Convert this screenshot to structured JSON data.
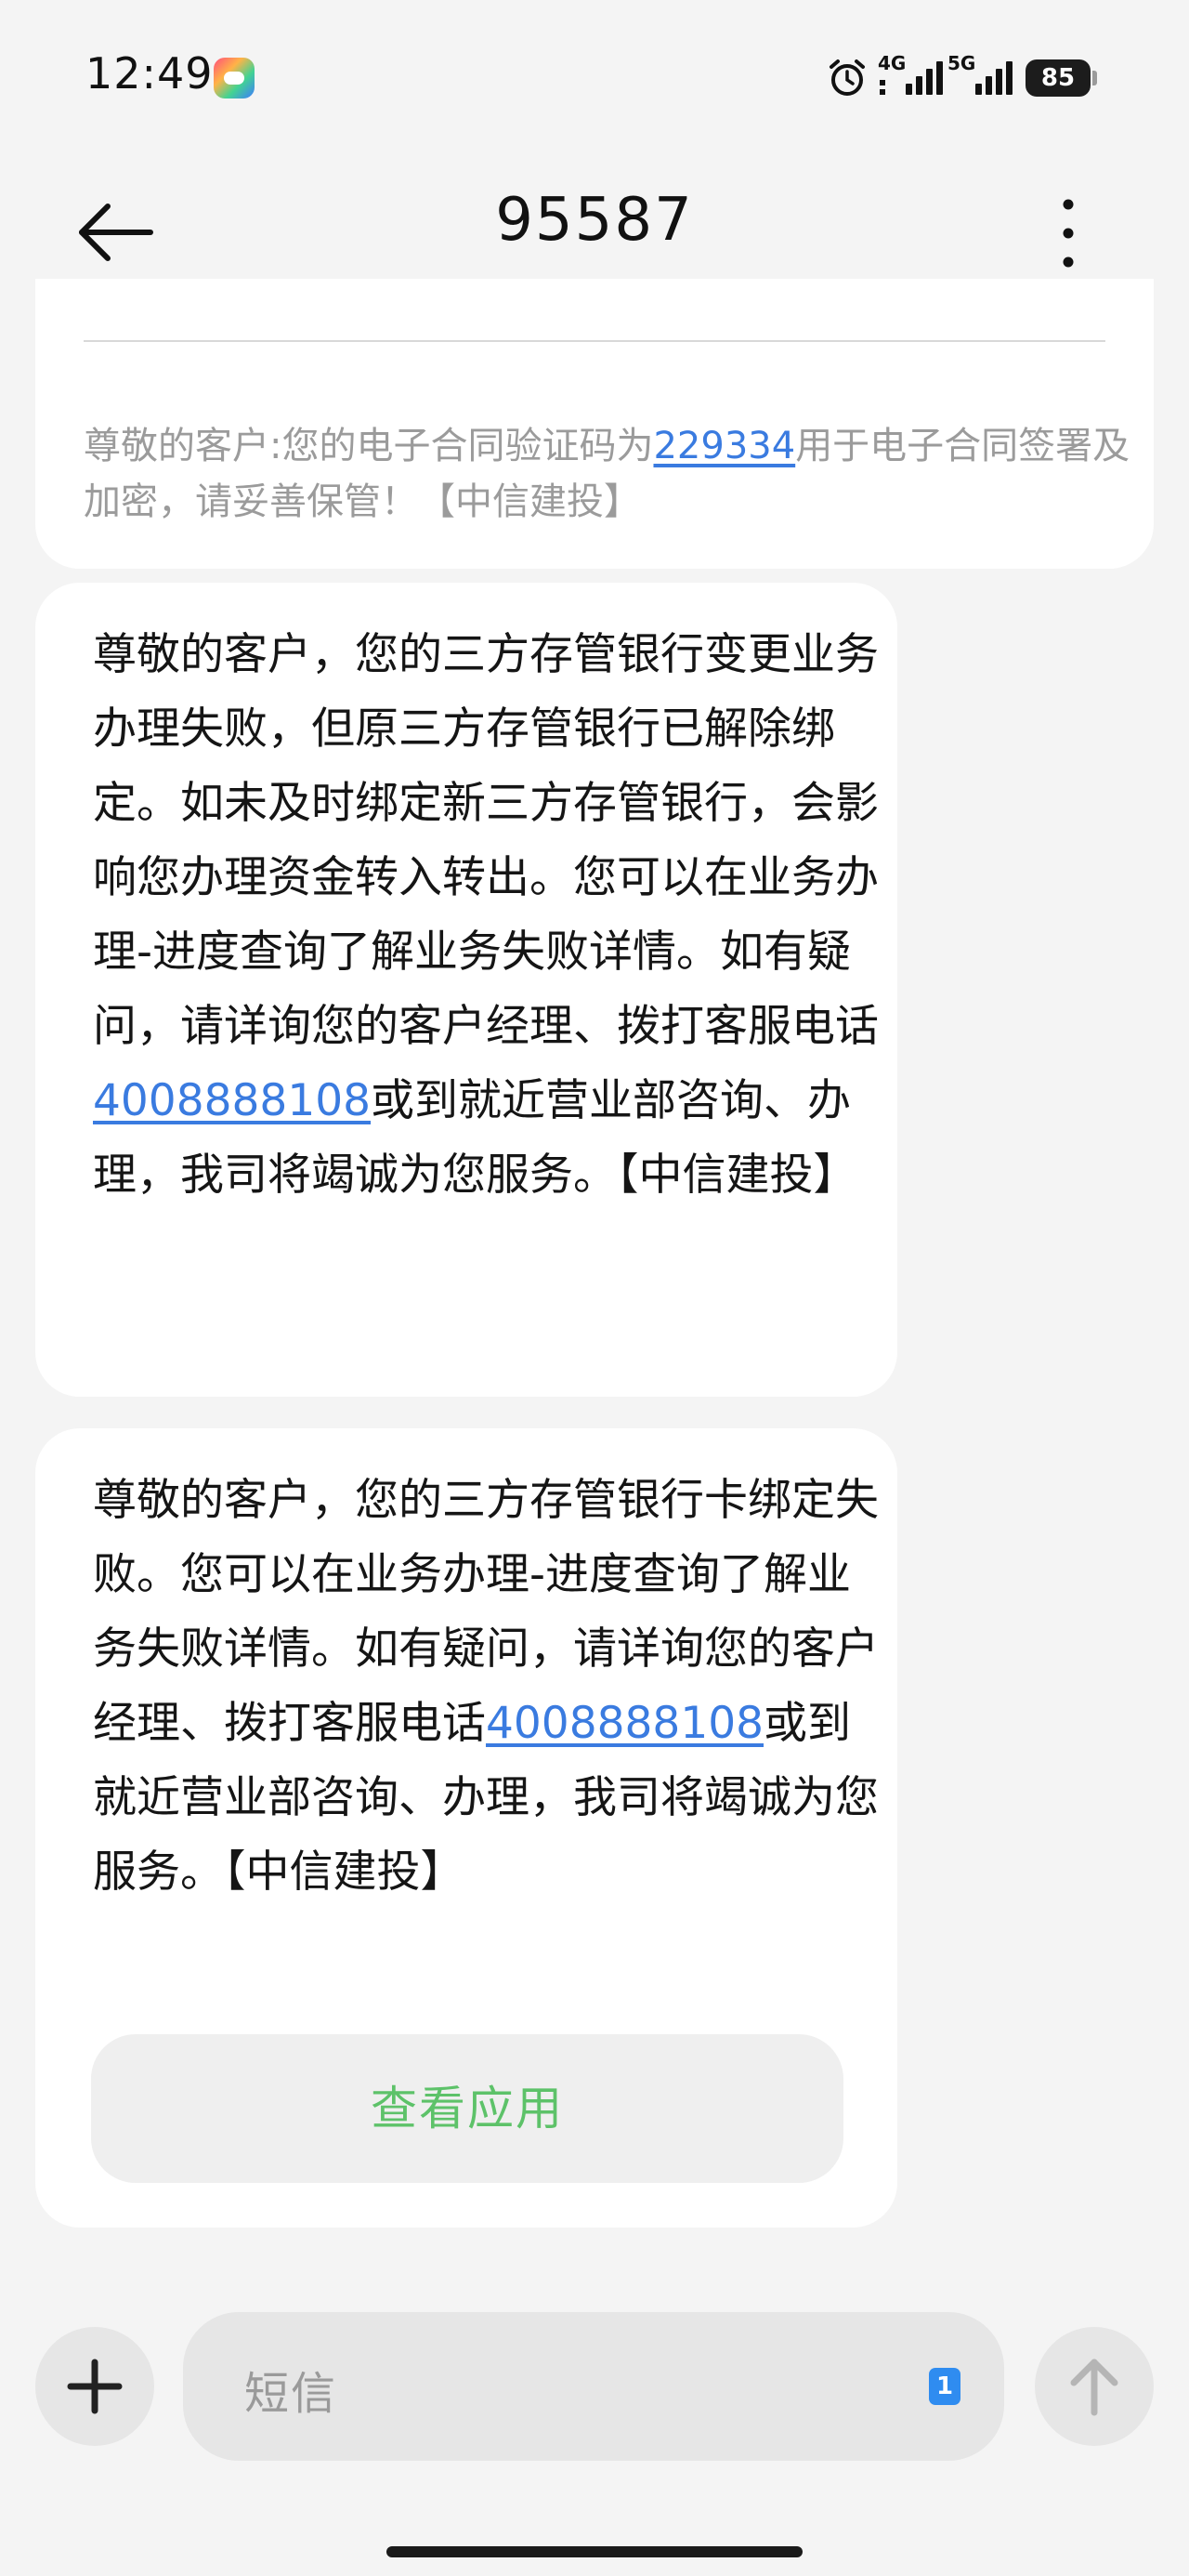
{
  "status_bar": {
    "time": "12:49",
    "network_1": "4G",
    "network_2": "5G",
    "battery": "85"
  },
  "header": {
    "title": "95587"
  },
  "messages": [
    {
      "pre": "尊敬的客户:您的电子合同验证码为",
      "link": "229334",
      "post": "用于电子合同签署及加密，请妥善保管！【中信建投】"
    },
    {
      "pre": "尊敬的客户，您的三方存管银行变更业务办理失败，但原三方存管银行已解除绑定。如未及时绑定新三方存管银行，会影响您办理资金转入转出。您可以在业务办理-进度查询了解业务失败详情。如有疑问，请详询您的客户经理、拨打客服电话",
      "link": "4008888108",
      "post": "或到就近营业部咨询、办理，我司将竭诚为您服务。【中信建投】"
    },
    {
      "pre": "尊敬的客户，您的三方存管银行卡绑定失败。您可以在业务办理-进度查询了解业务失败详情。如有疑问，请详询您的客户经理、拨打客服电话",
      "link": "4008888108",
      "post": "或到就近营业部咨询、办理，我司将竭诚为您服务。【中信建投】",
      "action_label": "查看应用"
    }
  ],
  "input": {
    "placeholder": "短信",
    "sim_badge": "1"
  },
  "icons": [
    "alarm-icon",
    "back-arrow-icon",
    "more-vertical-icon",
    "plus-icon",
    "arrow-up-icon"
  ],
  "colors": {
    "background": "#f4f4f4",
    "bubble": "#ffffff",
    "link": "#3a7be0",
    "action_text": "#5dc269",
    "muted_text": "#9b9b9b"
  }
}
